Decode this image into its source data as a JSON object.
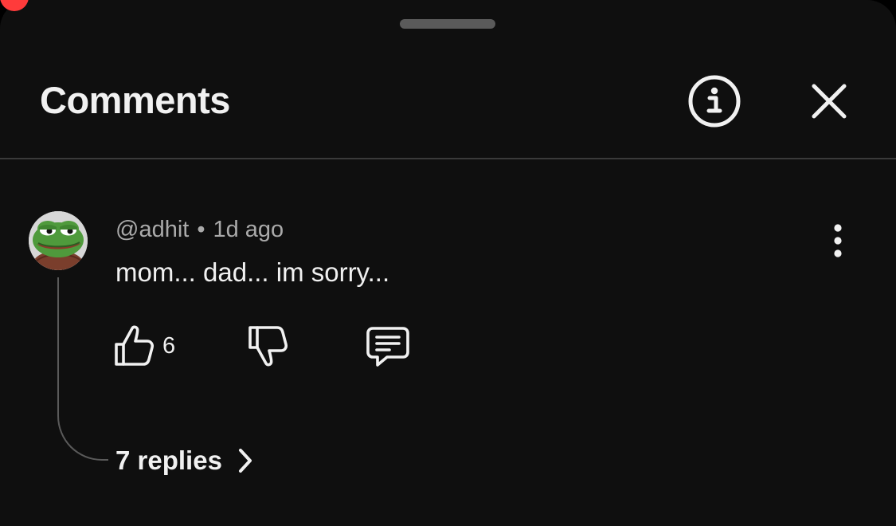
{
  "panel": {
    "title": "Comments"
  },
  "comment": {
    "author": "@adhit",
    "separator": "•",
    "time_ago": "1d ago",
    "text": "mom... dad... im sorry...",
    "like_count": "6",
    "replies_label": "7 replies"
  },
  "icons": {
    "info": "info-icon",
    "close": "close-icon",
    "more": "more-vertical-icon",
    "like": "thumbs-up-icon",
    "dislike": "thumbs-down-icon",
    "reply": "comment-reply-icon",
    "chevron": "chevron-right-icon"
  },
  "colors": {
    "background": "#0f0f0f",
    "primary_text": "#f1f1f1",
    "secondary_text": "#aaaaaa",
    "divider": "#3a3a3a",
    "indicator_dot": "#ff3b3b"
  }
}
